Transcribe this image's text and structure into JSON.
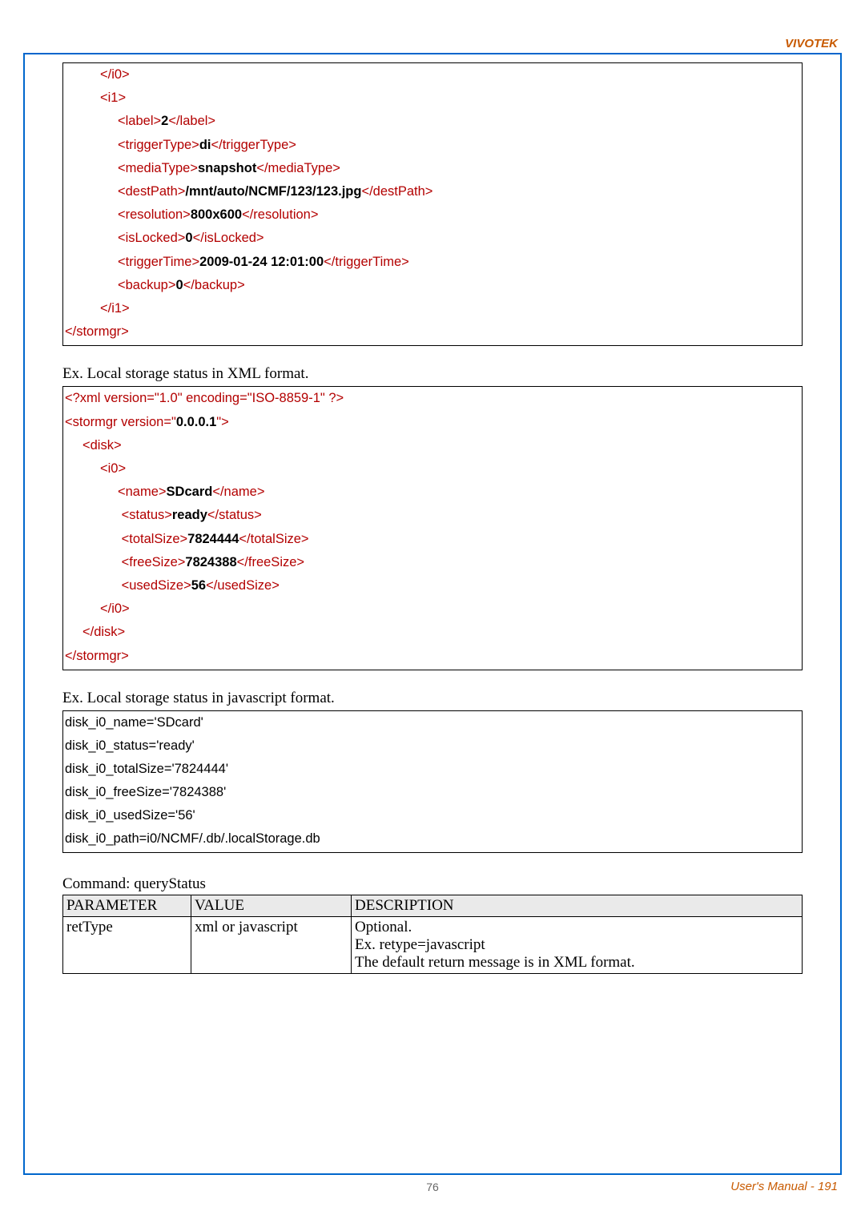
{
  "brand": "VIVOTEK",
  "footer_page": "76",
  "footer_right": "User's Manual - 191",
  "xml1": {
    "close_i0": "</i0>",
    "open_i1": "<i1>",
    "label_open": "<label>",
    "label_val": "2",
    "label_close": "</label>",
    "trig_open": "<triggerType>",
    "trig_val": "di",
    "trig_close": "</triggerType>",
    "media_open": "<mediaType>",
    "media_val": "snapshot",
    "media_close": "</mediaType>",
    "dest_open": "<destPath>",
    "dest_val": "/mnt/auto/NCMF/123/123.jpg",
    "dest_close": "</destPath>",
    "res_open": "<resolution>",
    "res_val": "800x600",
    "res_close": "</resolution>",
    "lock_open": "<isLocked>",
    "lock_val": "0",
    "lock_close": "</isLocked>",
    "time_open": "<triggerTime>",
    "time_val": "2009-01-24 12:01:00",
    "time_close": "</triggerTime>",
    "bak_open": "<backup>",
    "bak_val": "0",
    "bak_close": "</backup>",
    "close_i1": "</i1>",
    "close_stormgr": "</stormgr>"
  },
  "para_xml_status": "Ex. Local storage status in XML format.",
  "xml2": {
    "decl_a": "<?xml version=\"",
    "decl_b": "1.0",
    "decl_c": "\" encoding=\"",
    "decl_d": "ISO-8859-1",
    "decl_e": "\" ?>",
    "stor_a": "<stormgr version=\"",
    "stor_b": "0.0.0.1",
    "stor_c": "\">",
    "disk_open": "<disk>",
    "i0_open": "<i0>",
    "name_open": "<name>",
    "name_val": "SDcard",
    "name_close": "</name>",
    "status_open": "<status>",
    "status_val": "ready",
    "status_close": "</status>",
    "total_open": "<totalSize>",
    "total_val": "7824444",
    "total_close": "</totalSize>",
    "free_open": "<freeSize>",
    "free_val": "7824388",
    "free_close": "</freeSize>",
    "used_open": "<usedSize>",
    "used_val": "56",
    "used_close": "</usedSize>",
    "i0_close": "</i0>",
    "disk_close": "</disk>",
    "stor_close": "</stormgr>"
  },
  "para_js_status": "Ex. Local storage status in javascript format.",
  "js": {
    "l1": "disk_i0_name='SDcard'",
    "l2": "disk_i0_status='ready'",
    "l3": "disk_i0_totalSize='7824444'",
    "l4": "disk_i0_freeSize='7824388'",
    "l5": "disk_i0_usedSize='56'",
    "l6": "disk_i0_path=i0/NCMF/.db/.localStorage.db"
  },
  "cmd_line": "Command: queryStatus",
  "table": {
    "h1": "PARAMETER",
    "h2": "VALUE",
    "h3": "DESCRIPTION",
    "r1c1": "retType",
    "r1c2": "xml or javascript",
    "r1c3a": "Optional.",
    "r1c3b": "Ex. retype=javascript",
    "r1c3c": "The default return message is in XML format."
  }
}
